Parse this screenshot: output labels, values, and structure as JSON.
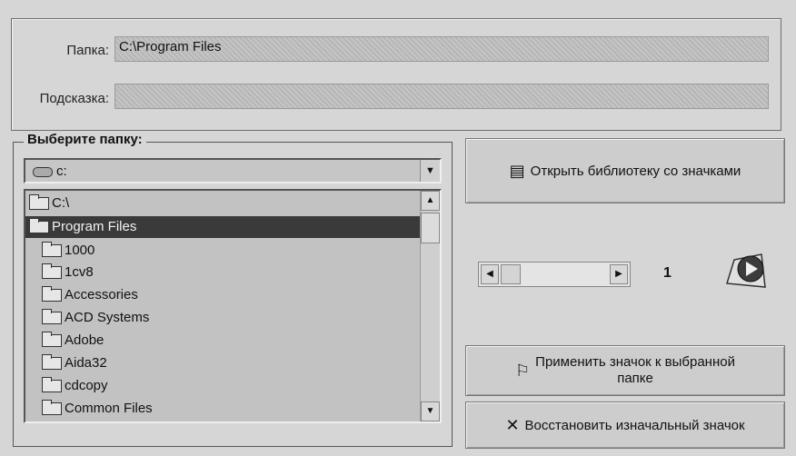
{
  "folder_row": {
    "label": "Папка:",
    "value": "C:\\Program Files"
  },
  "hint_row": {
    "label": "Подсказка:",
    "value": ""
  },
  "select_group": {
    "title": "Выберите папку:"
  },
  "drive_combo": {
    "value": "c:",
    "icon": "drive-icon"
  },
  "folder_list": {
    "items": [
      {
        "label": "C:\\",
        "icon": "open-folder-icon",
        "selected": false
      },
      {
        "label": "Program Files",
        "icon": "open-folder-icon",
        "selected": true
      },
      {
        "label": "1000",
        "icon": "folder-icon",
        "selected": false
      },
      {
        "label": "1cv8",
        "icon": "folder-icon",
        "selected": false
      },
      {
        "label": "Accessories",
        "icon": "folder-icon",
        "selected": false
      },
      {
        "label": "ACD Systems",
        "icon": "folder-icon",
        "selected": false
      },
      {
        "label": "Adobe",
        "icon": "folder-icon",
        "selected": false
      },
      {
        "label": "Aida32",
        "icon": "folder-icon",
        "selected": false
      },
      {
        "label": "cdcopy",
        "icon": "folder-icon",
        "selected": false
      },
      {
        "label": "Common Files",
        "icon": "folder-icon",
        "selected": false
      }
    ]
  },
  "buttons": {
    "open_library": "Открыть библиотеку со значками",
    "apply_line1": "Применить значок к выбранной",
    "apply_line2": "папке",
    "restore": "Восстановить изначальный значок"
  },
  "icon_index": "1",
  "colors": {
    "background": "#d6d6d6",
    "selection": "#3a3a3a",
    "field": "#bdbdbd"
  }
}
